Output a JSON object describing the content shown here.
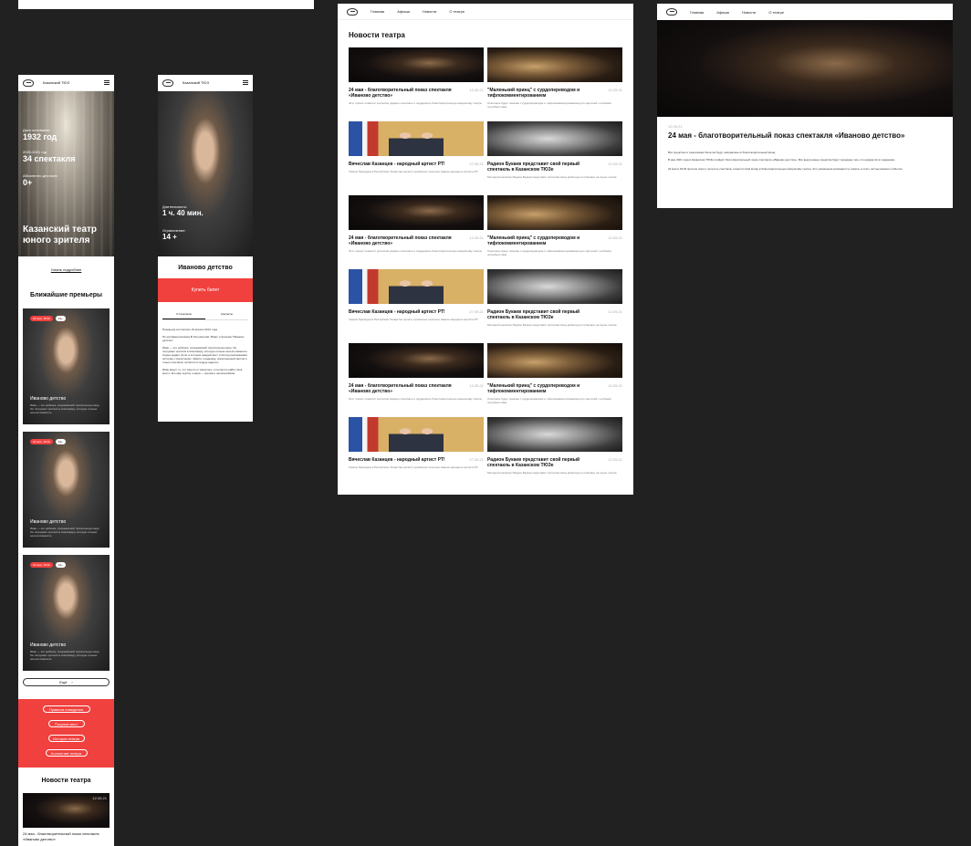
{
  "colors": {
    "background": "#212121",
    "accent": "#f0413f",
    "surface": "#ffffff"
  },
  "nav": {
    "main": "Главная",
    "afisha": "Афиша",
    "news": "Новости",
    "about": "О театре"
  },
  "mobile_home": {
    "theatre_name": "Казанский ТЮЗ",
    "stats": [
      {
        "label": "Дата основания",
        "value": "1932 год"
      },
      {
        "label": "2020-2021 год",
        "value": "34 спектакля"
      },
      {
        "label": "Абсолютно для всех",
        "value": "0+"
      }
    ],
    "hero_title": "Казанский театр юного зрителя",
    "learn_more": "Узнать подробнее",
    "premieres_heading": "Ближайшие премьеры",
    "premieres": [
      {
        "date": "24 мая, 18:30",
        "age": "14+",
        "title": "Иваново детство",
        "desc": "Иван — это ребёнок, сохранивший трогательную веру. Он погружает зрителя в атмосферу, которую отныне нельзя изменить."
      },
      {
        "date": "24 мая, 18:30",
        "age": "14+",
        "title": "Иваново детство",
        "desc": "Иван — это ребёнок, сохранивший трогательную веру. Он погружает зрителя в атмосферу, которую отныне нельзя изменить."
      },
      {
        "date": "24 мая, 18:30",
        "age": "14+",
        "title": "Иваново детство",
        "desc": "Иван — это ребёнок, сохранивший трогательную веру. Он погружает зрителя в атмосферу, которую отныне нельзя изменить."
      }
    ],
    "more_button": "Ещё",
    "menu_buttons": [
      "Правила поведения",
      "Покупка мест",
      "История театра",
      "Коллектив театра"
    ],
    "news_heading": "Новости театра",
    "news_preview": {
      "date": "12.05.21",
      "title": "24 мая - благотворительный показ спектакля «Иваново детство»"
    }
  },
  "mobile_show": {
    "theatre_name": "Казанский ТЮЗ",
    "duration_label": "Длительность:",
    "duration": "1 ч. 40 мин.",
    "age_label": "Ограничение:",
    "age": "14 +",
    "title": "Иваново детство",
    "buy_button": "Купить билет",
    "tabs": [
      "О спектакле",
      "Контакты"
    ],
    "premiere": "Премьера состоялась 19 апреля 2021 года",
    "para1": "По мотивам рассказа В. Богомолова \"Иван\" и фильма \"Иваново детство\"",
    "para2": "Иван — это ребёнок, сохранивший трогательную веру. Он погружает зрителя в атмосферу, которую отныне нельзя изменить. Сцена задаёт ритм, в котором каждый жест и взгляд рассказывает историю о взрослении, памяти и надежде. Наполненный светом и тенью спектакль остаётся в сердце надолго.",
    "para3": "Иван видит то, что скрыто от взрослых, и пытается найти своё место. Его мир хрупок, а вера — крепка и непоколебима."
  },
  "news_page": {
    "heading": "Новости театра",
    "items": [
      {
        "title": "24 мая - благотворительный показ спектакля «Иваново детство»",
        "date": "12.05.21",
        "photo": "dark",
        "text": "Этот проект позволит зрителям увидеть спектакль и поддержать благотворительную инициативу театра."
      },
      {
        "title": "\"Маленький принц\" с сурдопереводом и тифлокомментированием",
        "date": "12.05.21",
        "photo": "stage",
        "text": "Спектакль будет показан с сурдопереводом и тифлокомментированием для зрителей с особыми потребностями."
      },
      {
        "title": "Вячеслав Казанцев - народный артист РТ!",
        "date": "27.05.21",
        "photo": "flags",
        "text": "Указом Президента Республики Татарстан артисту присвоено почётное звание народного артиста РТ."
      },
      {
        "title": "Радион Букаев представит свой первый спектакль в Казанском ТЮЗе",
        "date": "12.05.21",
        "photo": "bw",
        "text": "Молодой режиссёр Радион Букаев представит зрителям свою дебютную постановку на сцене театра."
      },
      {
        "title": "24 мая - благотворительный показ спектакля «Иваново детство»",
        "date": "12.05.21",
        "photo": "dark",
        "text": "Этот проект позволит зрителям увидеть спектакль и поддержать благотворительную инициативу театра."
      },
      {
        "title": "\"Маленький принц\" с сурдопереводом и тифлокомментированием",
        "date": "12.05.21",
        "photo": "stage",
        "text": "Спектакль будет показан с сурдопереводом и тифлокомментированием для зрителей с особыми потребностями."
      },
      {
        "title": "Вячеслав Казанцев - народный артист РТ!",
        "date": "27.05.21",
        "photo": "flags",
        "text": "Указом Президента Республики Татарстан артисту присвоено почётное звание народного артиста РТ."
      },
      {
        "title": "Радион Букаев представит свой первый спектакль в Казанском ТЮЗе",
        "date": "12.05.21",
        "photo": "bw",
        "text": "Молодой режиссёр Радион Букаев представит зрителям свою дебютную постановку на сцене театра."
      },
      {
        "title": "24 мая - благотворительный показ спектакля «Иваново детство»",
        "date": "12.05.21",
        "photo": "dark",
        "text": "Этот проект позволит зрителям увидеть спектакль и поддержать благотворительную инициативу театра."
      },
      {
        "title": "\"Маленький принц\" с сурдопереводом и тифлокомментированием",
        "date": "12.05.21",
        "photo": "stage",
        "text": "Спектакль будет показан с сурдопереводом и тифлокомментированием для зрителей с особыми потребностями."
      },
      {
        "title": "Вячеслав Казанцев - народный артист РТ!",
        "date": "27.05.21",
        "photo": "flags",
        "text": "Указом Президента Республики Татарстан артисту присвоено почётное звание народного артиста РТ."
      },
      {
        "title": "Радион Букаев представит свой первый спектакль в Казанском ТЮЗе",
        "date": "12.05.21",
        "photo": "bw",
        "text": "Молодой режиссёр Радион Букаев представит зрителям свою дебютную постановку на сцене театра."
      }
    ]
  },
  "article": {
    "date": "12.05.21",
    "title": "24 мая - благотворительный показ спектакля «Иваново детство»",
    "intro": "Все средства от реализации билетов будут направлены в благотворительный фонд.",
    "body1": "В мае 2021 года в Казанском ТЮЗе пройдёт благотворительный показ спектакля «Иваново детство». Все вырученные средства будут переданы тем, кто нуждается в поддержке.",
    "body2": "24 мая в 18:30 зрители смогут посетить спектакль и внести свой вклад в благотворительную инициативу театра. Это уникальная возможность помочь и стать частью важного события."
  }
}
